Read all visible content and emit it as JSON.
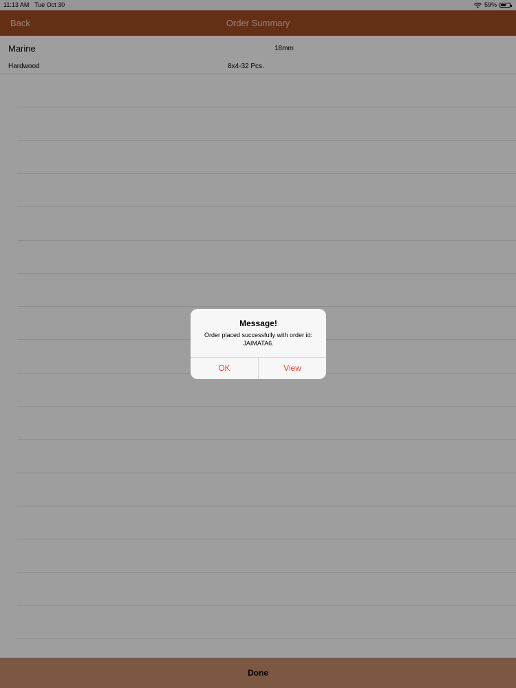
{
  "status_bar": {
    "time": "11:13 AM",
    "date": "Tue Oct 30",
    "battery": "59%",
    "battery_level": 0.59,
    "wifi_icon": "wifi-icon",
    "battery_icon": "battery-icon"
  },
  "nav": {
    "back_label": "Back",
    "title": "Order Summary",
    "bar_color": "#a24e23"
  },
  "order": {
    "name": "Marine",
    "size": "18mm",
    "type": "Hardwood",
    "quantity": "8x4-32 Pcs."
  },
  "footer": {
    "done_label": "Done"
  },
  "alert": {
    "title": "Message!",
    "message": "Order placed successfully with order id: JAIMATA6.",
    "ok_label": "OK",
    "view_label": "View",
    "button_color": "#e8463a"
  }
}
